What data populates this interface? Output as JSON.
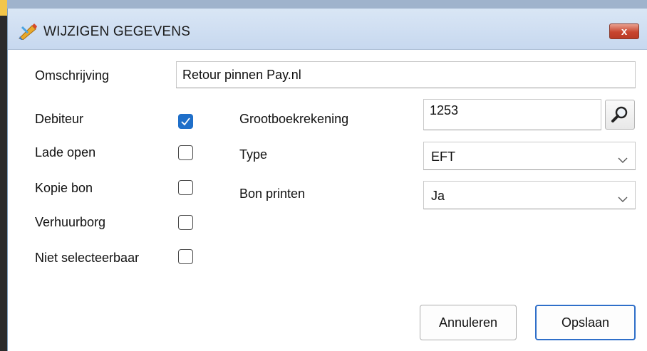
{
  "window": {
    "title": "WIJZIGEN GEGEVENS",
    "close_label": "x"
  },
  "form": {
    "omschrijving_label": "Omschrijving",
    "omschrijving_value": "Retour pinnen Pay.nl",
    "checkboxes": [
      {
        "label": "Debiteur",
        "checked": true
      },
      {
        "label": "Lade open",
        "checked": false
      },
      {
        "label": "Kopie bon",
        "checked": false
      },
      {
        "label": "Verhuurborg",
        "checked": false
      },
      {
        "label": "Niet selecteerbaar",
        "checked": false
      }
    ],
    "grootboek_label": "Grootboekrekening",
    "grootboek_value": "1253",
    "type_label": "Type",
    "type_value": "EFT",
    "bon_printen_label": "Bon printen",
    "bon_printen_value": "Ja"
  },
  "buttons": {
    "cancel": "Annuleren",
    "save": "Opslaan"
  },
  "colors": {
    "accent": "#1f6fc9",
    "titlebar": "#c7d8ef",
    "close": "#c8452f"
  },
  "icons": {
    "app": "pen-icon",
    "search": "magnifier-icon",
    "dropdown": "chevron-down-icon",
    "check": "checkmark-icon"
  }
}
